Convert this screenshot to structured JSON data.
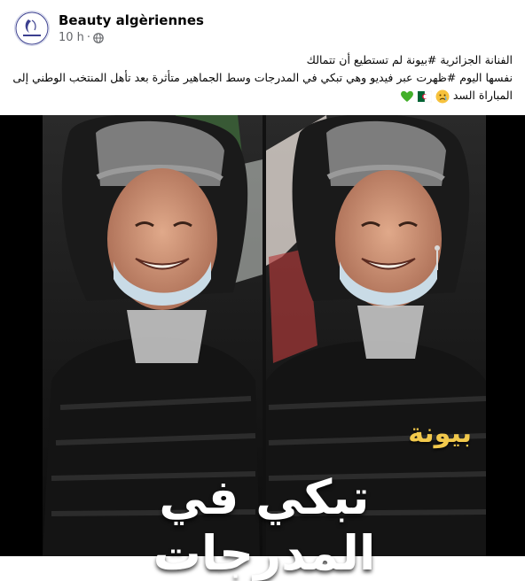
{
  "post": {
    "author": "Beauty algèriennes",
    "time": "10 h",
    "separator": "·",
    "privacy_icon": "globe-icon",
    "avatar_icon": "page-logo-icon"
  },
  "caption": {
    "line1": "الفنانة الجزائرية #بيونة لم تستطيع أن تتمالك",
    "line2": "نفسها اليوم #ظهرت عبر فيديو وهي تبكي في المدرجات وسط الجماهير متأثرة بعد تأهل المنتخب الوطني إلى",
    "line3": "المباراة السد",
    "emojis": [
      "sad-face-icon",
      "algeria-flag-icon",
      "green-heart-icon"
    ]
  },
  "media": {
    "overlay_name": "بيونة",
    "overlay_title": "تبكي في المدرجات",
    "colors": {
      "name": "#f2c94c",
      "title": "#ffffff",
      "background": "#000000"
    }
  }
}
